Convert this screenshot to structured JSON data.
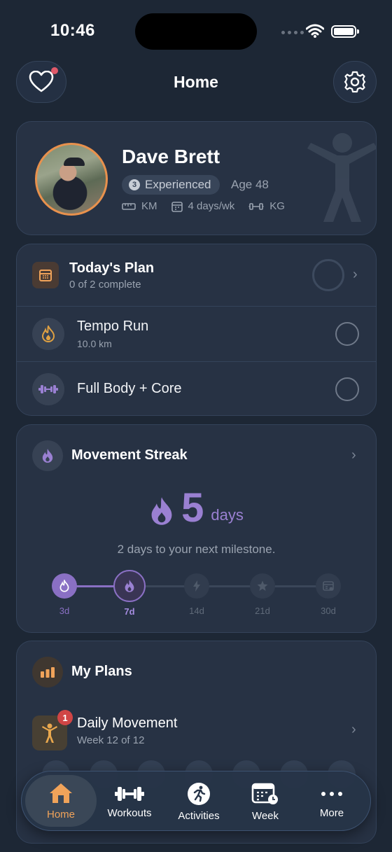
{
  "status": {
    "time": "10:46"
  },
  "header": {
    "title": "Home",
    "has_notification": true
  },
  "profile": {
    "name": "Dave Brett",
    "level_number": "3",
    "level": "Experienced",
    "age": "Age 48",
    "distance_unit": "KM",
    "frequency": "4 days/wk",
    "weight_unit": "KG"
  },
  "todays_plan": {
    "title": "Today's Plan",
    "subtitle": "0 of 2 complete",
    "progress": 0,
    "items": [
      {
        "title": "Tempo Run",
        "subtitle": "10.0 km",
        "icon": "flame-icon",
        "done": false
      },
      {
        "title": "Full Body + Core",
        "subtitle": "",
        "icon": "dumbbell-icon",
        "done": false
      }
    ]
  },
  "streak": {
    "title": "Movement Streak",
    "count": "5",
    "unit": "days",
    "message": "2 days to your next milestone.",
    "milestones": [
      {
        "label": "3d",
        "state": "achieved",
        "icon": "flame-icon"
      },
      {
        "label": "7d",
        "state": "current",
        "icon": "flame-icon"
      },
      {
        "label": "14d",
        "state": "locked",
        "icon": "bolt-icon"
      },
      {
        "label": "21d",
        "state": "locked",
        "icon": "star-icon"
      },
      {
        "label": "30d",
        "state": "locked",
        "icon": "calendar-check-icon"
      }
    ]
  },
  "my_plans": {
    "title": "My Plans",
    "plan": {
      "title": "Daily Movement",
      "subtitle": "Week 12 of 12",
      "badge": "1"
    }
  },
  "tabbar": {
    "active": "Home",
    "tabs": [
      "Home",
      "Workouts",
      "Activities",
      "Week",
      "More"
    ]
  },
  "colors": {
    "background": "#1d2735",
    "card": "#273244",
    "accent_orange": "#f0a35a",
    "accent_purple": "#9a80d2",
    "badge_red": "#d04545"
  }
}
